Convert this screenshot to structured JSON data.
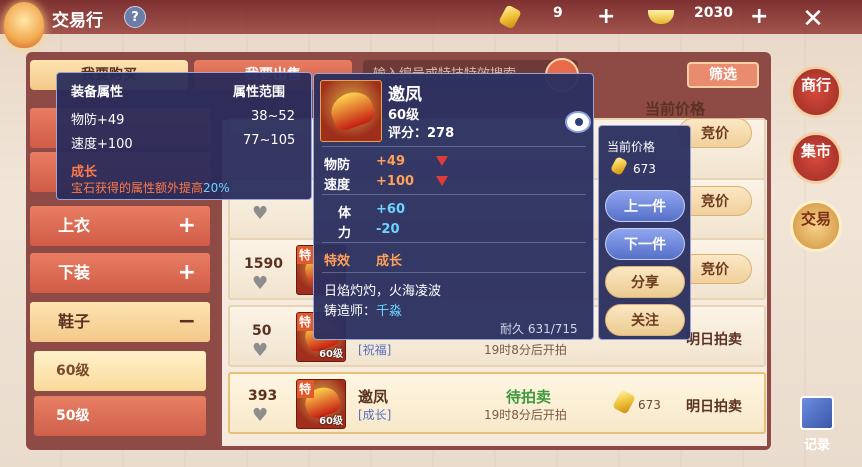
{
  "header": {
    "title": "交易行",
    "help": "?",
    "currency1": "9",
    "currency2": "2030"
  },
  "tabs": {
    "buy": "我要购买",
    "sell": "我要出售"
  },
  "search": {
    "placeholder": "输入编号或特技特效搜索"
  },
  "filter": "筛选",
  "list_header": {
    "price": "当前价格"
  },
  "sidebar": {
    "categories": [
      {
        "label": "上衣",
        "toggle": "+"
      },
      {
        "label": "下装",
        "toggle": "+"
      },
      {
        "label": "鞋子",
        "toggle": "−"
      }
    ],
    "subs": [
      "60级",
      "50级"
    ]
  },
  "attr_tooltip": {
    "col1": "装备属性",
    "col2": "属性范围",
    "rows": [
      {
        "name": "物防+49",
        "range": "38~52"
      },
      {
        "name": "速度+100",
        "range": "77~105"
      }
    ],
    "growth_title": "成长",
    "growth_desc": "宝石获得的属性额外提高",
    "growth_pct": "20%"
  },
  "detail": {
    "name": "邀凤",
    "level": "60级",
    "score": "评分：278",
    "stats": [
      {
        "k": "物防",
        "v": "+49"
      },
      {
        "k": "速度",
        "v": "+100"
      }
    ],
    "extra": [
      {
        "k": "体",
        "v": "+60"
      },
      {
        "k": "力",
        "v": "-20"
      }
    ],
    "effect_label": "特效",
    "effect_value": "成长",
    "desc": "日焰灼灼，火海凌波",
    "maker_label": "铸造师：",
    "maker": "千淼",
    "durability": "耐久 631/715"
  },
  "price_popup": {
    "label": "当前价格",
    "price": "673",
    "buttons": [
      "上一件",
      "下一件",
      "分享",
      "关注"
    ]
  },
  "rows": [
    {
      "fav": "",
      "title": "",
      "bid": "竞价"
    },
    {
      "fav": "",
      "title": "",
      "bid": "竞价"
    },
    {
      "fav": "1590",
      "title": "",
      "bid": "竞价",
      "badge": "特"
    },
    {
      "fav": "50",
      "tag": "[祝福]",
      "time": "19时8分后开拍",
      "status": "明日拍卖",
      "badge": "特",
      "lv": "60级"
    },
    {
      "fav": "393",
      "name": "邀凤",
      "tag": "[成长]",
      "state": "待拍卖",
      "time": "19时8分后开拍",
      "price": "673",
      "status": "明日拍卖",
      "badge": "特",
      "lv": "60级"
    }
  ],
  "right_nav": [
    "商行",
    "集市",
    "交易"
  ],
  "record": "记录",
  "colors": {
    "accent": "#d15c47",
    "tooltip": "#2c3060",
    "gold": "#f0c23a"
  }
}
